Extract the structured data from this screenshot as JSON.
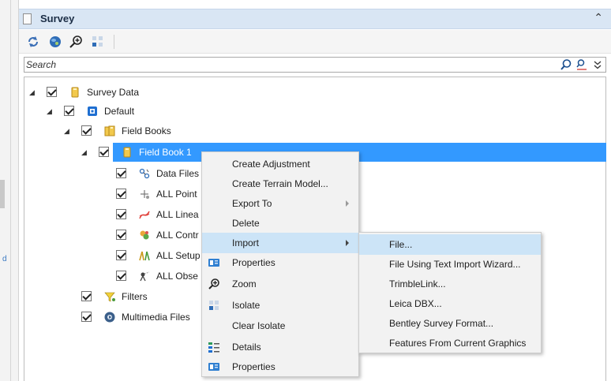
{
  "panel": {
    "title": "Survey",
    "collapse_glyph": "⌃",
    "accent": "#d9e6f4"
  },
  "toolbar": {
    "icons": [
      "refresh-icon",
      "globe-icon",
      "zoom-icon",
      "isolate-icon"
    ]
  },
  "search": {
    "placeholder": "Search",
    "value": ""
  },
  "tree": {
    "selected_color": "#3399ff",
    "nodes": [
      {
        "label": "Survey Data",
        "icon": "folder-icon"
      },
      {
        "label": "Default",
        "icon": "default-icon"
      },
      {
        "label": "Field Books",
        "icon": "field-books-icon"
      },
      {
        "label": "Field Book 1",
        "icon": "field-book-icon"
      },
      {
        "label": "Data Files",
        "icon": "data-files-icon"
      },
      {
        "label": "ALL Point",
        "icon": "points-icon"
      },
      {
        "label": "ALL Linea",
        "icon": "lineal-icon"
      },
      {
        "label": "ALL Contr",
        "icon": "control-icon"
      },
      {
        "label": "ALL Setup",
        "icon": "setup-icon"
      },
      {
        "label": "ALL Obse",
        "icon": "observations-icon"
      },
      {
        "label": "Filters",
        "icon": "filter-icon"
      },
      {
        "label": "Multimedia Files",
        "icon": "multimedia-icon"
      }
    ]
  },
  "context_menu": {
    "items": [
      {
        "label": "Create Adjustment"
      },
      {
        "label": "Create Terrain Model..."
      },
      {
        "label": "Export To"
      },
      {
        "label": "Delete"
      },
      {
        "label": "Import"
      },
      {
        "label": "Properties"
      },
      {
        "label": "Zoom"
      },
      {
        "label": "Isolate"
      },
      {
        "label": "Clear Isolate"
      },
      {
        "label": "Details"
      },
      {
        "label": "Properties"
      }
    ]
  },
  "import_submenu": {
    "items": [
      {
        "label": "File..."
      },
      {
        "label": "File Using Text Import Wizard..."
      },
      {
        "label": "TrimbleLink..."
      },
      {
        "label": "Leica DBX..."
      },
      {
        "label": "Bentley Survey Format..."
      },
      {
        "label": "Features From Current Graphics"
      }
    ]
  },
  "left_strip": {
    "fragment": "d"
  }
}
